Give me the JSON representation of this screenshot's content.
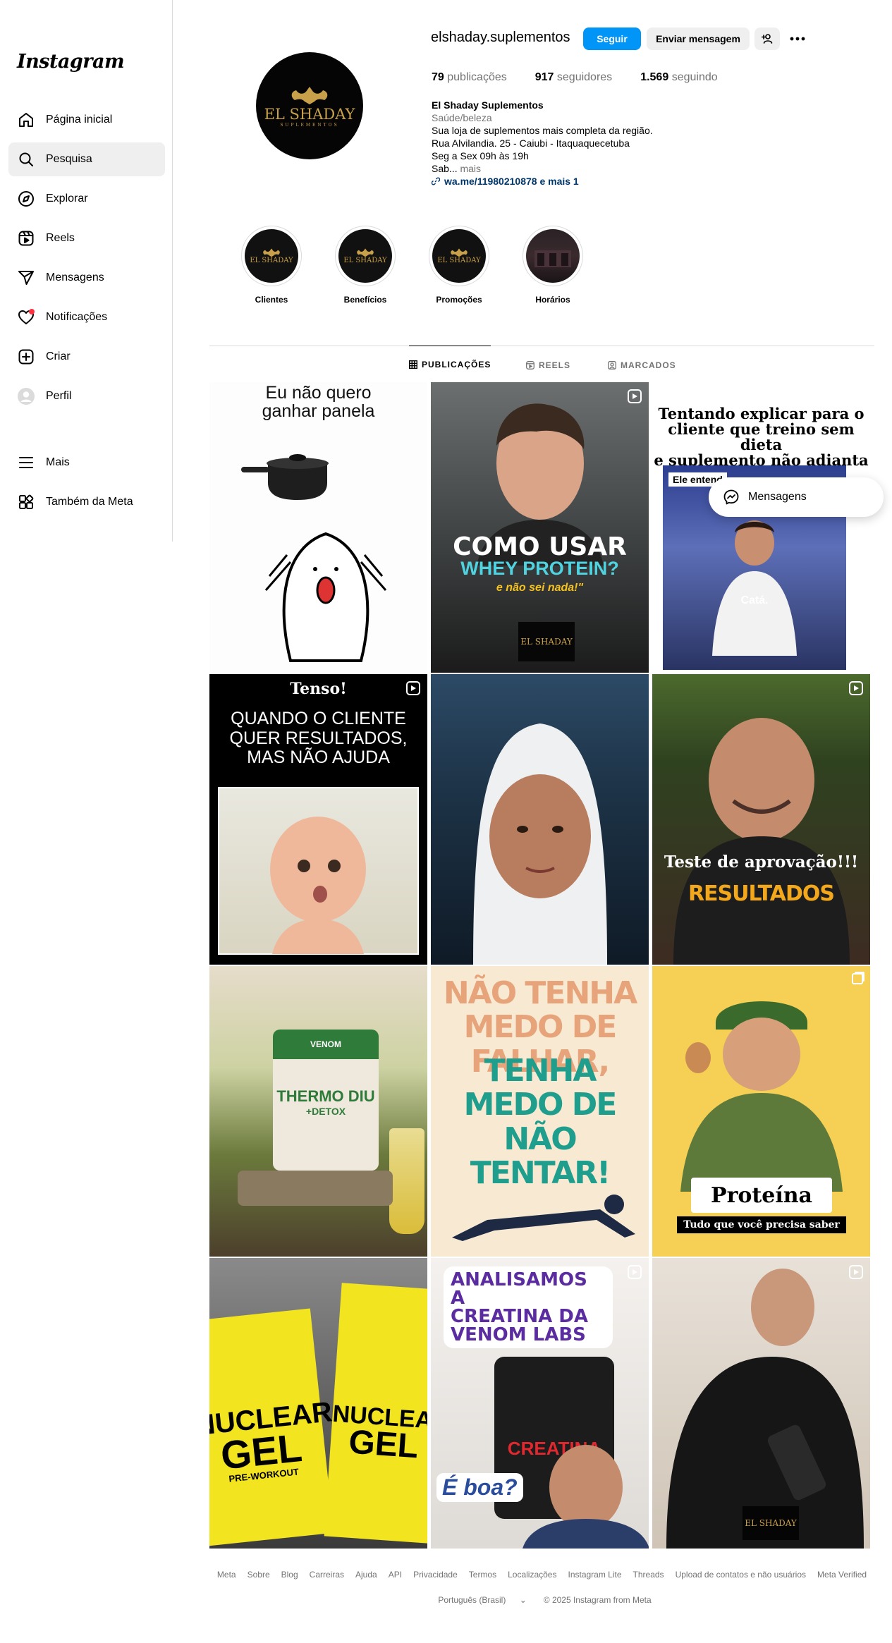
{
  "sidebar": {
    "logo": "Instagram",
    "items": [
      {
        "label": "Página inicial",
        "icon": "home-icon"
      },
      {
        "label": "Pesquisa",
        "icon": "search-icon"
      },
      {
        "label": "Explorar",
        "icon": "compass-icon"
      },
      {
        "label": "Reels",
        "icon": "reels-icon"
      },
      {
        "label": "Mensagens",
        "icon": "send-icon"
      },
      {
        "label": "Notificações",
        "icon": "heart-icon"
      },
      {
        "label": "Criar",
        "icon": "plus-square-icon"
      },
      {
        "label": "Perfil",
        "icon": "avatar-icon"
      },
      {
        "label": "Mais",
        "icon": "menu-icon"
      },
      {
        "label": "Também da Meta",
        "icon": "meta-apps-icon"
      }
    ]
  },
  "profile": {
    "username": "elshaday.suplementos",
    "avatar_text": "EL SHADAY",
    "avatar_subtext": "SUPLEMENTOS",
    "follow_label": "Seguir",
    "message_label": "Enviar mensagem",
    "stats": {
      "posts_count": "79",
      "posts_label": "publicações",
      "followers_count": "917",
      "followers_label": "seguidores",
      "following_count": "1.569",
      "following_label": "seguindo"
    },
    "bio": {
      "name": "El Shaday Suplementos",
      "category": "Saúde/beleza",
      "line1": "Sua loja de suplementos mais completa da região.",
      "line2": "Rua Alvilandia. 25 - Caiubi - Itaquaquecetuba",
      "line3": "Seg a Sex 09h às 19h",
      "line4": "Sab...",
      "more": " mais",
      "link": "wa.me/11980210878 e mais 1"
    }
  },
  "highlights": [
    {
      "label": "Clientes"
    },
    {
      "label": "Benefícios"
    },
    {
      "label": "Promoções"
    },
    {
      "label": "Horários"
    }
  ],
  "tabs": [
    {
      "label": "PUBLICAÇÕES"
    },
    {
      "label": "REELS"
    },
    {
      "label": "MARCADOS"
    }
  ],
  "posts": {
    "p1": {
      "l1": "Eu não quero",
      "l2": "ganhar panela"
    },
    "p2": {
      "l1": "COMO USAR",
      "l2": "WHEY PROTEIN?",
      "l3": "e não sei nada!\""
    },
    "p3": {
      "l1": "Tentando explicar para o",
      "l2": "cliente que treino sem dieta",
      "l3": "e suplemento não adianta",
      "tag": "Ele entend",
      "sub": "Catá."
    },
    "p4": {
      "l1": "Tenso!",
      "l2": "QUANDO O CLIENTE",
      "l3": "QUER RESULTADOS,",
      "l4": "MAS NÃO AJUDA"
    },
    "p6": {
      "l1": "Teste de aprovação!!!",
      "l2": "RESULTADOS"
    },
    "p7": {
      "brand": "VENOM",
      "l1": "THERMO DIU",
      "l2": "+DETOX"
    },
    "p8": {
      "l1": "NÃO TENHA",
      "l2": "MEDO DE FALHAR,",
      "l3": "TENHA MEDO DE",
      "l4": "NÃO TENTAR!"
    },
    "p9": {
      "l1": "Proteína",
      "l2": "Tudo que você precisa saber"
    },
    "p10": {
      "l1": "NUCLEAR",
      "l2": "GEL",
      "l3": "PRE-WORKOUT"
    },
    "p11": {
      "l1": "ANALISAMOS A",
      "l2": "CREATINA DA",
      "l3": "VENOM LABS",
      "l4": "CREATINA",
      "l5": "É boa?"
    }
  },
  "messages_popup": {
    "label": "Mensagens"
  },
  "footer": {
    "links": [
      "Meta",
      "Sobre",
      "Blog",
      "Carreiras",
      "Ajuda",
      "API",
      "Privacidade",
      "Termos",
      "Localizações",
      "Instagram Lite",
      "Threads",
      "Upload de contatos e não usuários",
      "Meta Verified"
    ],
    "language": "Português (Brasil)",
    "copyright": "© 2025 Instagram from Meta"
  },
  "colors": {
    "accent": "#0095f6",
    "link": "#00376b",
    "muted": "#737373",
    "notif": "#ff3040"
  }
}
